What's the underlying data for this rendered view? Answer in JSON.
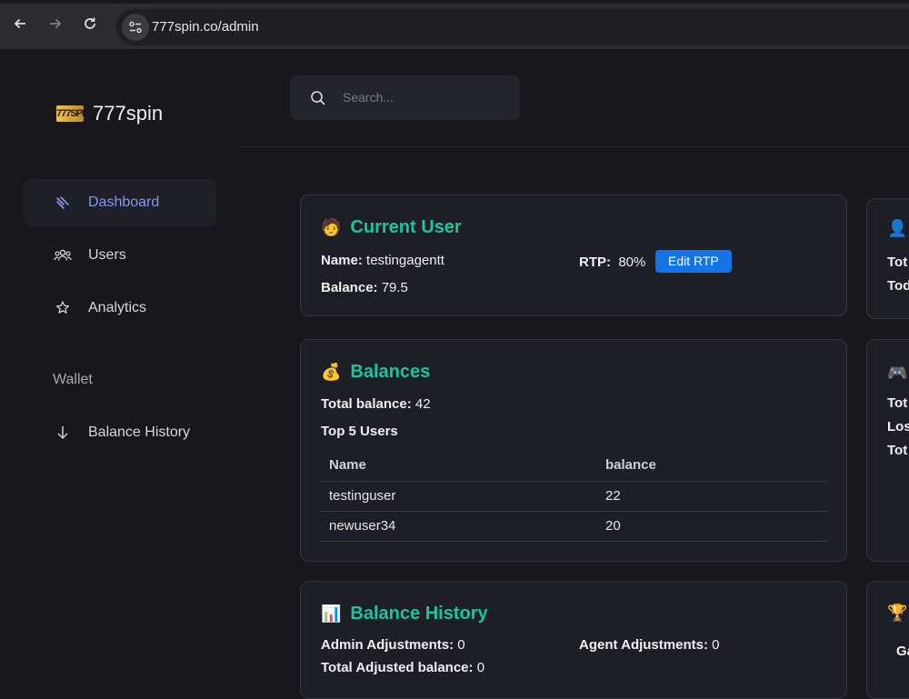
{
  "browser": {
    "url": "777spin.co/admin",
    "icons": {
      "back": "arrow-left-icon",
      "forward": "arrow-right-icon",
      "reload": "reload-icon",
      "site_info": "tune-icon"
    }
  },
  "sidebar": {
    "logo_mark": "777SPIN",
    "brand": "777spin",
    "items": [
      {
        "label": "Dashboard",
        "icon": "dashboard-icon",
        "active": true
      },
      {
        "label": "Users",
        "icon": "users-icon",
        "active": false
      },
      {
        "label": "Analytics",
        "icon": "analytics-icon",
        "active": false
      }
    ],
    "section_wallet": "Wallet",
    "wallet_items": [
      {
        "label": "Balance History",
        "icon": "arrow-down-icon"
      }
    ]
  },
  "search": {
    "placeholder": "Search..."
  },
  "current_user": {
    "emoji": "🧑",
    "title": "Current User",
    "name_label": "Name:",
    "name_value": "testingagentt",
    "balance_label": "Balance:",
    "balance_value": "79.5",
    "rtp_label": "RTP:",
    "rtp_value": "80%",
    "edit_rtp": "Edit RTP"
  },
  "balances": {
    "emoji": "💰",
    "title": "Balances",
    "total_label": "Total balance:",
    "total_value": "42",
    "top_users_label": "Top 5 Users",
    "columns": [
      "Name",
      "balance"
    ],
    "rows": [
      [
        "testinguser",
        "22"
      ],
      [
        "newuser34",
        "20"
      ]
    ]
  },
  "balance_history": {
    "emoji": "📊",
    "title": "Balance History",
    "admin_label": "Admin Adjustments:",
    "admin_value": "0",
    "agent_label": "Agent Adjustments:",
    "agent_value": "0",
    "total_label": "Total Adjusted balance:",
    "total_value": "0"
  },
  "right_cards": {
    "card1": {
      "emoji": "👤",
      "line1": "Tot",
      "line2": "Tod"
    },
    "card2": {
      "emoji": "🎮",
      "line1": "Tot",
      "line2": "Los",
      "line3": "Tot"
    },
    "card3": {
      "emoji": "🏆",
      "line1": "Ga"
    }
  },
  "colors": {
    "accent": "#17c6a0",
    "active_nav": "#8f93f5",
    "button": "#1473e6",
    "background": "#17171c",
    "card": "#1e1e26"
  }
}
